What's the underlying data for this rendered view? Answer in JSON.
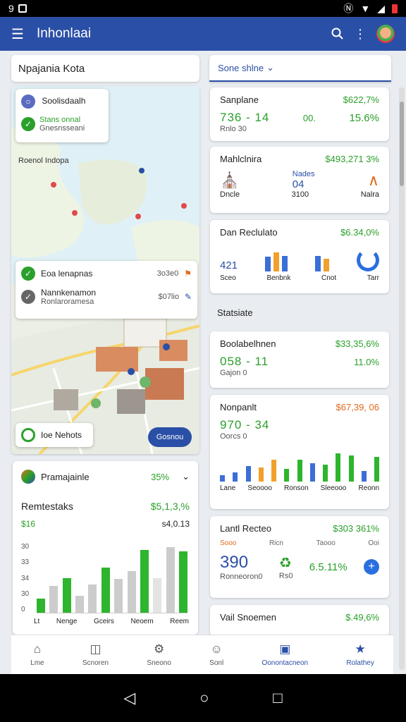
{
  "statusbar": {
    "time": "9",
    "notif_icon": "image-icon"
  },
  "topbar": {
    "title": "Inhonlaai",
    "menu_icon": "menu-icon",
    "search_icon": "search-icon",
    "more_icon": "more-vert-icon"
  },
  "search": {
    "text": "Npajania Kota"
  },
  "tab": {
    "label": "Sone shlne"
  },
  "map": {
    "popup1": {
      "row1": "Soolisdaalh",
      "row2a": "Stans onnal",
      "row2b": "Gnesnsseani"
    },
    "region_label": "Roenol Indopa",
    "popup2": {
      "row1a": "Eoa lenapnas",
      "row1b": "3o3e0",
      "row2a": "Nannkenamon",
      "row2b": "Ronlaroramesa",
      "row2c": "$07lio"
    },
    "bottom_chip": "Ioe Nehots",
    "bottom_button": "Gosnou"
  },
  "left_card": {
    "header_label": "Pramajainle",
    "header_value": "35%",
    "title": "Remtestaks",
    "title_value": "$5,1,3,%",
    "sub_left": "$16",
    "sub_right": "s4,0.13",
    "y_ticks": [
      "30",
      "33",
      "34",
      "30",
      "0"
    ],
    "x_labels": [
      "Lt",
      "Nenge",
      "Gceirs",
      "Neoem",
      "Reem"
    ]
  },
  "right_cards": [
    {
      "title": "Sanplane",
      "value": "$622,7%",
      "big": "736 - 14",
      "mid": "00.",
      "pct": "15.6%",
      "sub": "Rnlo     30"
    },
    {
      "title": "Mahlclnira",
      "value": "$493,271 3%",
      "sub1": "Nades",
      "sub2": "04",
      "sub3": "3100",
      "foot": "Dncle",
      "foot2": "Nalra"
    },
    {
      "title": "Dan Reclulato",
      "value": "$6.34,0%",
      "big": "421",
      "labels": [
        "Sceo",
        "Benbnk",
        "Cnot",
        "Tarr"
      ]
    },
    {
      "title": "Boolabelhnen",
      "value": "$33,35,6%",
      "big": "058 - 11",
      "sub": "Gajon     0",
      "pct": "11.0%"
    },
    {
      "title": "Nonpanlt",
      "value": "$67,39, 06",
      "big": "970 - 34",
      "sub": "Oorcs     0",
      "labels": [
        "Lane",
        "Seoooo",
        "Ronson",
        "Sleeooo",
        "Reonn"
      ]
    },
    {
      "title": "Lantl Recteo",
      "value": "$303 361%",
      "sub": [
        "Sooo",
        "Ricn",
        "Taooo",
        "Ooi"
      ],
      "big": "390",
      "big2": "Ronneoron0",
      "mid": "Rs0",
      "pct": "6.5.11%"
    },
    {
      "title": "Vail Snoemen",
      "value": "$.49,6%"
    }
  ],
  "section_label": "Statsiate",
  "nav": {
    "items": [
      "Lme",
      "Scnoren",
      "Sneono",
      "Sonl",
      "Oonontacneon",
      "Rolathey"
    ]
  },
  "colors": {
    "brand": "#2a4fa6",
    "positive": "#2aa02a",
    "warn": "#e26a1b"
  }
}
